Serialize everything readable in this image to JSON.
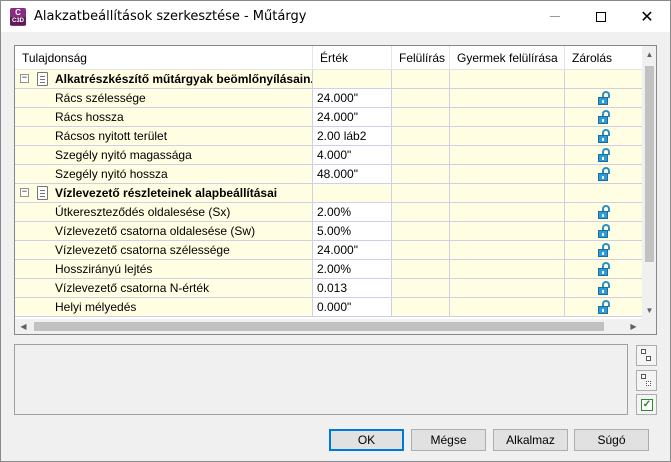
{
  "window": {
    "title": "Alakzatbeállítások szerkesztése - Műtárgy",
    "app_icon_letter": "C",
    "app_icon_sub": "C3D",
    "minimize_icon": "minimize-icon",
    "maximize_icon": "maximize-icon",
    "close_icon": "close-icon"
  },
  "grid": {
    "columns": [
      "Tulajdonság",
      "Érték",
      "Felülírás",
      "Gyermek felülírása",
      "Zárolás"
    ],
    "rows": [
      {
        "type": "group",
        "label": "Alkatrészkészítő műtárgyak beömlőnyílásain...",
        "value": "",
        "expanded": true
      },
      {
        "type": "item",
        "label": "Rács szélessége",
        "value": "24.000\"",
        "locked": true
      },
      {
        "type": "item",
        "label": "Rács hossza",
        "value": "24.000\"",
        "locked": true
      },
      {
        "type": "item",
        "label": "Rácsos nyitott terület",
        "value": "2.00 láb2",
        "locked": true
      },
      {
        "type": "item",
        "label": "Szegély nyitó magassága",
        "value": "4.000\"",
        "locked": true
      },
      {
        "type": "item",
        "label": "Szegély nyitó hossza",
        "value": "48.000\"",
        "locked": true
      },
      {
        "type": "group",
        "label": "Vízlevezető részleteinek alapbeállításai",
        "value": "",
        "expanded": true
      },
      {
        "type": "item",
        "label": "Útkereszteződés oldalesése (Sx)",
        "value": "2.00%",
        "locked": true
      },
      {
        "type": "item",
        "label": "Vízlevezető csatorna oldalesése (Sw)",
        "value": "5.00%",
        "locked": true
      },
      {
        "type": "item",
        "label": "Vízlevezető csatorna szélessége",
        "value": "24.000\"",
        "locked": true
      },
      {
        "type": "item",
        "label": "Hosszirányú lejtés",
        "value": "2.00%",
        "locked": true
      },
      {
        "type": "item",
        "label": "Vízlevezető csatorna N-érték",
        "value": "0.013",
        "locked": true
      },
      {
        "type": "item",
        "label": "Helyi mélyedés",
        "value": "0.000\"",
        "locked": true
      }
    ],
    "expander_symbol": "⊟"
  },
  "side_buttons": {
    "expand_all_icon": "expand-all-icon",
    "collapse_all_icon": "collapse-all-icon",
    "toggle_check_icon": "check-icon"
  },
  "buttons": {
    "ok": "OK",
    "cancel": "Mégse",
    "apply": "Alkalmaz",
    "help": "Súgó"
  },
  "colors": {
    "row_bg": "#fffde2",
    "grid_line": "#cfcfe6",
    "lock_blue": "#2e9bd6",
    "focus_blue": "#0078d7"
  }
}
